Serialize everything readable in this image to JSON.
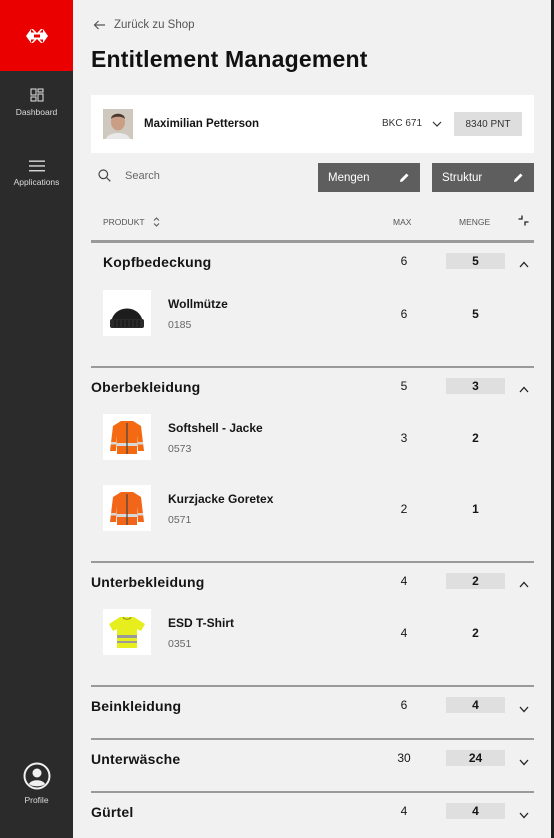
{
  "sidebar": {
    "dashboard_label": "Dashboard",
    "applications_label": "Applications",
    "profile_label": "Profile"
  },
  "header": {
    "back_label": "Zurück zu Shop",
    "title": "Entitlement Management"
  },
  "user": {
    "name": "Maximilian Petterson",
    "account": "BKC 671",
    "points": "8340 PNT"
  },
  "toolbar": {
    "search_placeholder": "Search",
    "mengen_label": "Mengen",
    "struktur_label": "Struktur"
  },
  "table": {
    "col_product": "PRODUKT",
    "col_max": "MAX",
    "col_menge": "MENGE"
  },
  "categories": [
    {
      "title": "Kopfbedeckung",
      "max": "6",
      "menge": "5",
      "expanded": true,
      "items": [
        {
          "name": "Wollmütze",
          "sku": "0185",
          "max": "6",
          "menge": "5",
          "image": "beanie"
        }
      ]
    },
    {
      "title": "Oberbekleidung",
      "max": "5",
      "menge": "3",
      "expanded": true,
      "items": [
        {
          "name": "Softshell - Jacke",
          "sku": "0573",
          "max": "3",
          "menge": "2",
          "image": "orange-jacket"
        },
        {
          "name": "Kurzjacke Goretex",
          "sku": "0571",
          "max": "2",
          "menge": "1",
          "image": "orange-jacket"
        }
      ]
    },
    {
      "title": "Unterbekleidung",
      "max": "4",
      "menge": "2",
      "expanded": true,
      "items": [
        {
          "name": "ESD T-Shirt",
          "sku": "0351",
          "max": "4",
          "menge": "2",
          "image": "yellow-tshirt"
        }
      ]
    },
    {
      "title": "Beinkleidung",
      "max": "6",
      "menge": "4",
      "expanded": false,
      "items": []
    },
    {
      "title": "Unterwäsche",
      "max": "30",
      "menge": "24",
      "expanded": false,
      "items": []
    },
    {
      "title": "Gürtel",
      "max": "4",
      "menge": "4",
      "expanded": false,
      "items": []
    }
  ],
  "colors": {
    "brand_red": "#eb0000",
    "sidebar": "#2b2b2b",
    "button": "#5e5e5e"
  }
}
